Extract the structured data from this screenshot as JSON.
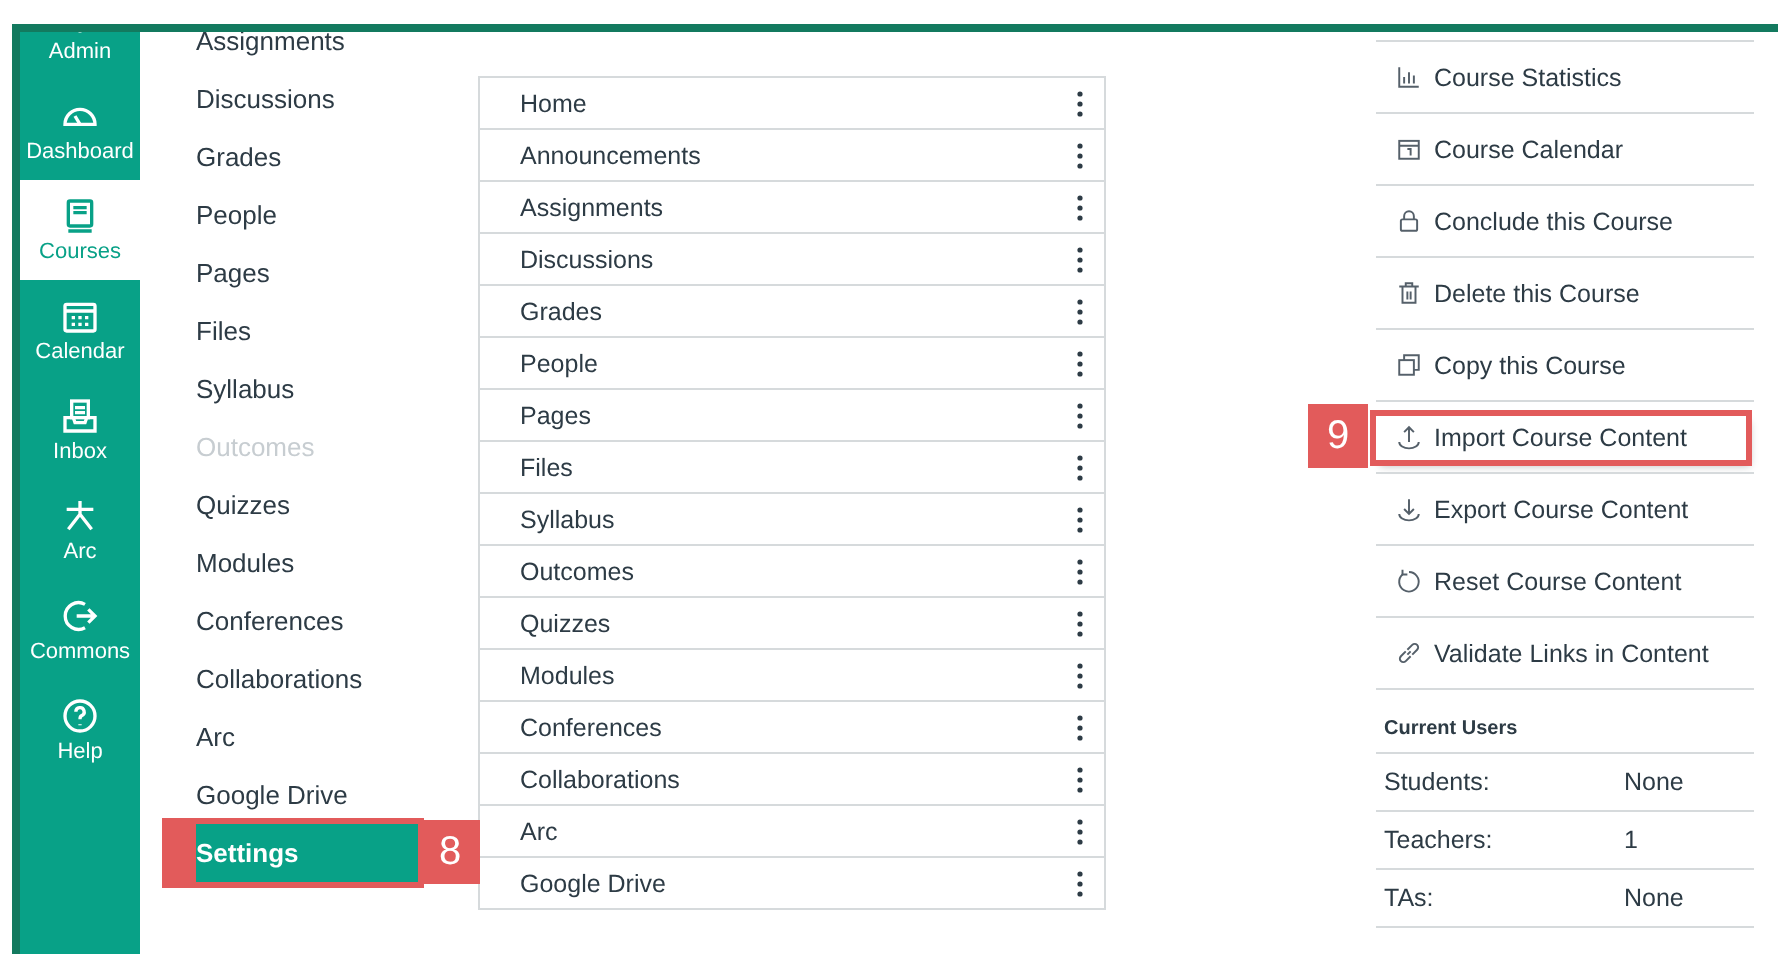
{
  "global_nav": [
    {
      "label": "Admin",
      "selected": false
    },
    {
      "label": "Dashboard",
      "selected": false
    },
    {
      "label": "Courses",
      "selected": true
    },
    {
      "label": "Calendar",
      "selected": false
    },
    {
      "label": "Inbox",
      "selected": false
    },
    {
      "label": "Arc",
      "selected": false
    },
    {
      "label": "Commons",
      "selected": false
    },
    {
      "label": "Help",
      "selected": false
    }
  ],
  "course_nav": [
    {
      "label": "Assignments",
      "selected": false,
      "disabled": false
    },
    {
      "label": "Discussions",
      "selected": false,
      "disabled": false
    },
    {
      "label": "Grades",
      "selected": false,
      "disabled": false
    },
    {
      "label": "People",
      "selected": false,
      "disabled": false
    },
    {
      "label": "Pages",
      "selected": false,
      "disabled": false
    },
    {
      "label": "Files",
      "selected": false,
      "disabled": false
    },
    {
      "label": "Syllabus",
      "selected": false,
      "disabled": false
    },
    {
      "label": "Outcomes",
      "selected": false,
      "disabled": true
    },
    {
      "label": "Quizzes",
      "selected": false,
      "disabled": false
    },
    {
      "label": "Modules",
      "selected": false,
      "disabled": false
    },
    {
      "label": "Conferences",
      "selected": false,
      "disabled": false
    },
    {
      "label": "Collaborations",
      "selected": false,
      "disabled": false
    },
    {
      "label": "Arc",
      "selected": false,
      "disabled": false
    },
    {
      "label": "Google Drive",
      "selected": false,
      "disabled": false
    },
    {
      "label": "Settings",
      "selected": true,
      "disabled": false,
      "callout": "8"
    }
  ],
  "navigation_list": [
    "Home",
    "Announcements",
    "Assignments",
    "Discussions",
    "Grades",
    "People",
    "Pages",
    "Files",
    "Syllabus",
    "Outcomes",
    "Quizzes",
    "Modules",
    "Conferences",
    "Collaborations",
    "Arc",
    "Google Drive"
  ],
  "sidebar_actions": [
    {
      "label": "Course Statistics"
    },
    {
      "label": "Course Calendar"
    },
    {
      "label": "Conclude this Course"
    },
    {
      "label": "Delete this Course"
    },
    {
      "label": "Copy this Course"
    },
    {
      "label": "Import Course Content",
      "callout": "9"
    },
    {
      "label": "Export Course Content"
    },
    {
      "label": "Reset Course Content"
    },
    {
      "label": "Validate Links in Content"
    }
  ],
  "current_users": {
    "heading": "Current Users",
    "rows": [
      {
        "label": "Students:",
        "value": "None"
      },
      {
        "label": "Teachers:",
        "value": "1"
      },
      {
        "label": "TAs:",
        "value": "None"
      }
    ]
  }
}
